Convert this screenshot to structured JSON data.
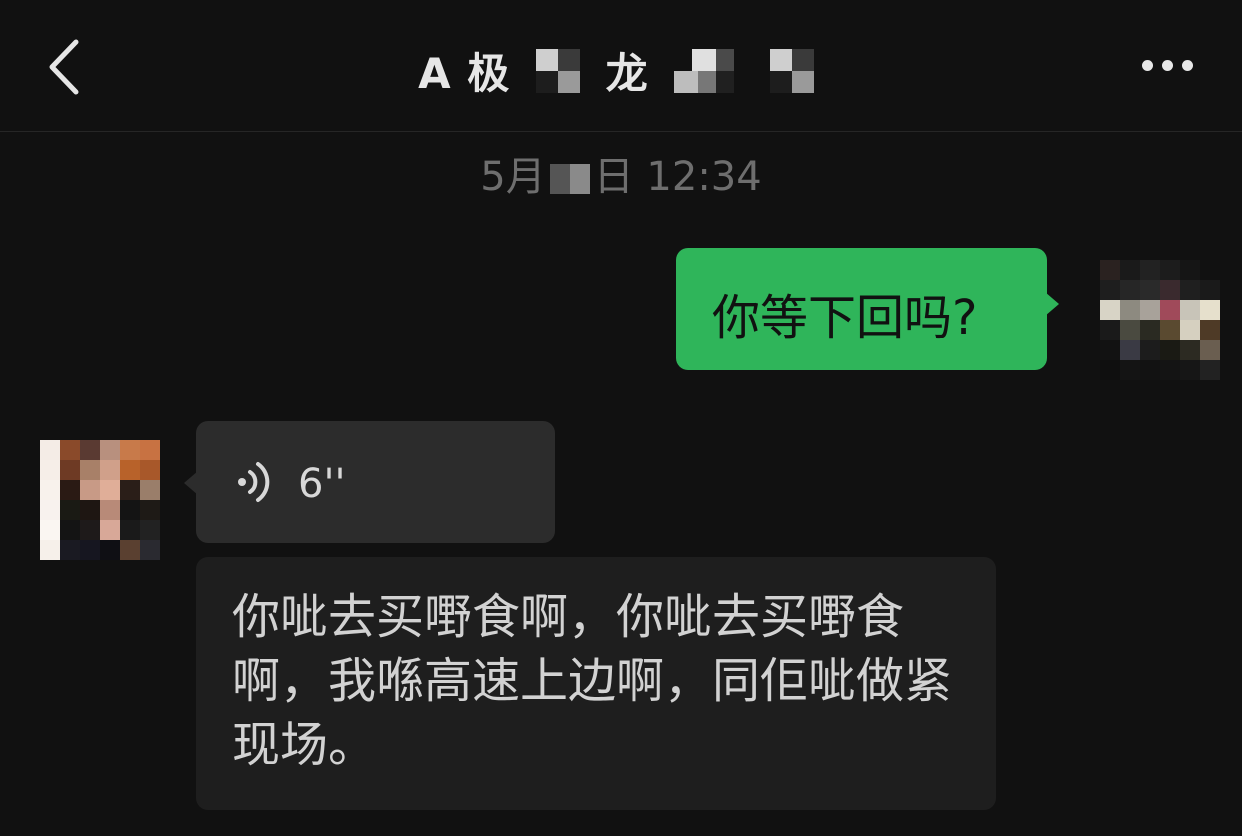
{
  "header": {
    "back_icon": "chevron-left-icon",
    "title_part1": "A 极",
    "title_part2": "龙",
    "more_icon": "more-horizontal-icon"
  },
  "timestamp": {
    "prefix": "5月",
    "suffix": "日 12:34"
  },
  "messages": {
    "outgoing_text": "你等下回吗?",
    "voice_duration": "6''",
    "voice_icon": "voice-wave-icon",
    "transcript": "你呲去买嘢食啊，你呲去买嘢食啊，我喺高速上边啊，同佢呲做紧现场。"
  },
  "colors": {
    "background": "#111111",
    "outgoing_bubble": "#2fb55a",
    "voice_bubble": "#2c2c2c",
    "transcript_bubble": "#1e1e1e"
  }
}
